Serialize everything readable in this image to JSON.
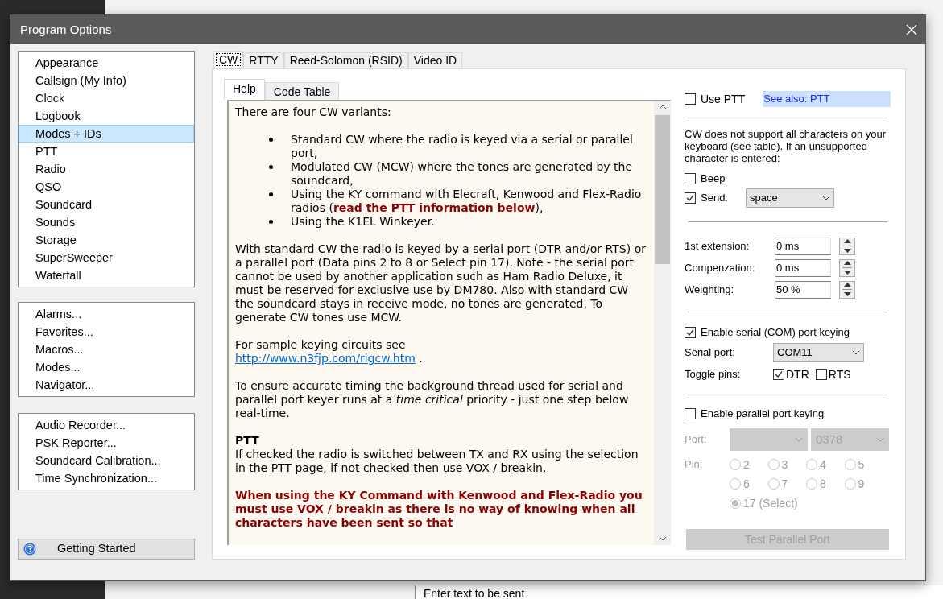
{
  "background_app": {
    "entry_hint": "Enter text to be sent"
  },
  "window": {
    "title": "Program Options"
  },
  "sidebar": {
    "groups": [
      {
        "items": [
          {
            "label": "Appearance",
            "selected": false
          },
          {
            "label": "Callsign (My Info)",
            "selected": false
          },
          {
            "label": "Clock",
            "selected": false
          },
          {
            "label": "Logbook",
            "selected": false
          },
          {
            "label": "Modes + IDs",
            "selected": true
          },
          {
            "label": "PTT",
            "selected": false
          },
          {
            "label": "Radio",
            "selected": false
          },
          {
            "label": "QSO",
            "selected": false
          },
          {
            "label": "Soundcard",
            "selected": false
          },
          {
            "label": "Sounds",
            "selected": false
          },
          {
            "label": "Storage",
            "selected": false
          },
          {
            "label": "SuperSweeper",
            "selected": false
          },
          {
            "label": "Waterfall",
            "selected": false
          }
        ]
      },
      {
        "items": [
          {
            "label": "Alarms...",
            "selected": false
          },
          {
            "label": "Favorites...",
            "selected": false
          },
          {
            "label": "Macros...",
            "selected": false
          },
          {
            "label": "Modes...",
            "selected": false
          },
          {
            "label": "Navigator...",
            "selected": false
          }
        ]
      },
      {
        "items": [
          {
            "label": "Audio Recorder...",
            "selected": false
          },
          {
            "label": "PSK Reporter...",
            "selected": false
          },
          {
            "label": "Soundcard Calibration...",
            "selected": false
          },
          {
            "label": "Time Synchronization...",
            "selected": false
          }
        ]
      }
    ],
    "getting_started": "Getting Started"
  },
  "tabs": [
    {
      "label": "CW",
      "selected": true
    },
    {
      "label": "RTTY",
      "selected": false
    },
    {
      "label": "Reed-Solomon (RSID)",
      "selected": false
    },
    {
      "label": "Video ID",
      "selected": false
    }
  ],
  "help_tabs": [
    {
      "label": "Help",
      "selected": true
    },
    {
      "label": "Code Table",
      "selected": false
    }
  ],
  "help": [
    {
      "kind": "text",
      "text": "There are four CW variants:"
    },
    {
      "kind": "bullets",
      "items": [
        "Standard CW where the radio is keyed via a serial or parallel port,",
        "Modulated CW (MCW) where the tones are generated by the soundcard,",
        "Using the KY command with Elecraft, Kenwood and Flex-Radio radios (**read the PTT information below**),",
        "Using the K1EL Winkeyer."
      ]
    },
    {
      "kind": "text",
      "text": "With standard CW the radio is keyed by a serial port (DTR and/or RTS) or a parallel port (Data pins 2 to 8 or Select pin 17). Note - the serial port cannot be used by another application such as Ham Radio Deluxe, it must be reserved for exclusive use by DM780. Also with standard CW the soundcard stays in receive mode, no tones are generated. To generate CW tones use MCW."
    },
    {
      "kind": "link",
      "text": "For sample keying circuits see",
      "link": "http://www.n3fjp.com/rigcw.htm",
      "after": "."
    },
    {
      "kind": "text",
      "text": "To ensure accurate timing the background thread used for serial and parallel port keyer runs at a *time critical* priority - just one step below real-time."
    },
    {
      "kind": "section",
      "heading": "PTT",
      "text": "If checked the radio is switched between TX and RX using the selection in the PTT page, if not checked then use VOX / breakin."
    },
    {
      "kind": "warning",
      "text": "When using the KY Command with Kenwood and Flex-Radio you must use VOX / breakin as there is no way of knowing when all characters have been sent so that"
    }
  ],
  "options": {
    "use_ptt": {
      "label": "Use PTT",
      "checked": false
    },
    "see_also": "See also: PTT",
    "unsupported_note": "CW does not support all characters on your keyboard (see table). If an unsupported character  is entered:",
    "beep": {
      "label": "Beep",
      "checked": false
    },
    "send": {
      "label": "Send:",
      "checked": true,
      "value": "space"
    },
    "spinners": [
      {
        "label": "1st extension:",
        "value": "0 ms"
      },
      {
        "label": "Compenzation:",
        "value": "0 ms"
      },
      {
        "label": "Weighting:",
        "value": "50 %"
      }
    ],
    "serial": {
      "label": "Enable serial (COM) port keying",
      "checked": true,
      "port_label": "Serial port:",
      "port": "COM11",
      "pins_label": "Toggle pins:",
      "pins": [
        {
          "label": "DTR",
          "checked": true
        },
        {
          "label": "RTS",
          "checked": false
        }
      ]
    },
    "parallel": {
      "label": "Enable parallel port keying",
      "checked": false,
      "disabled": true,
      "port_label": "Port:",
      "address": "0378",
      "pin_label": "Pin:",
      "pins": [
        {
          "label": "2",
          "selected": false
        },
        {
          "label": "3",
          "selected": false
        },
        {
          "label": "4",
          "selected": false
        },
        {
          "label": "5",
          "selected": false
        },
        {
          "label": "6",
          "selected": false
        },
        {
          "label": "7",
          "selected": false
        },
        {
          "label": "8",
          "selected": false
        },
        {
          "label": "9",
          "selected": false
        },
        {
          "label": "17 (Select)",
          "selected": true
        }
      ],
      "test_button": "Test Parallel Port"
    }
  }
}
